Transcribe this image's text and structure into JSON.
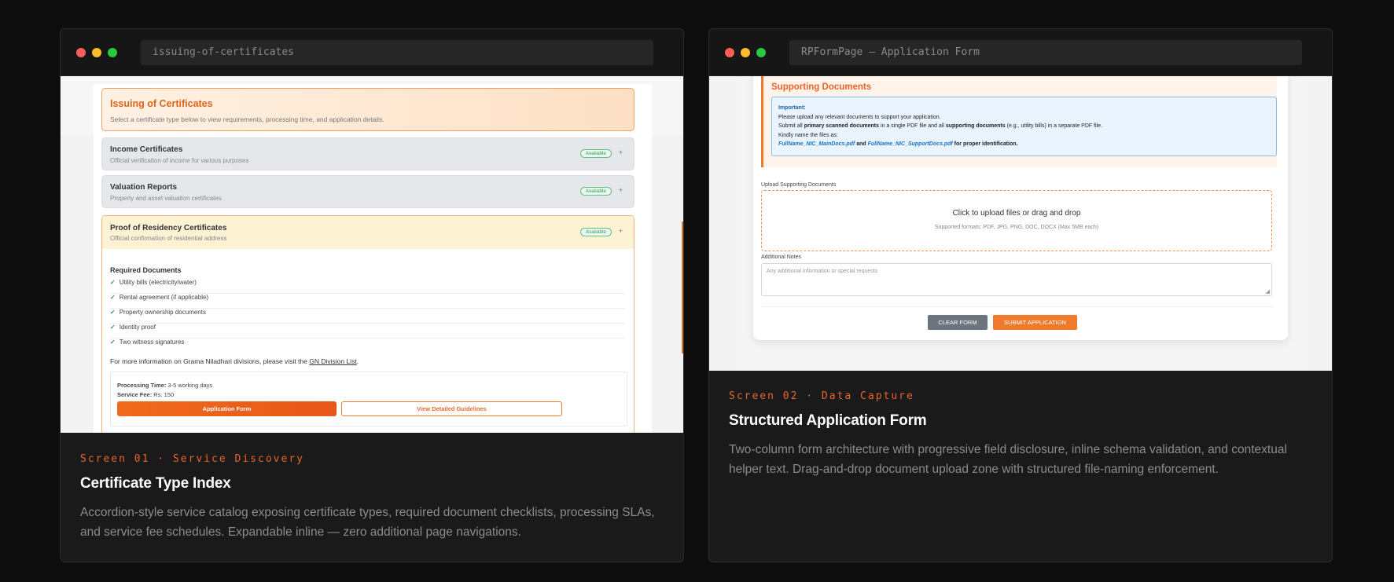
{
  "cards": [
    {
      "url": "issuing-of-certificates",
      "eyebrow": "Screen 01 · Service Discovery",
      "title": "Certificate Type Index",
      "description": "Accordion-style service catalog exposing certificate types, required document checklists, processing SLAs, and service fee schedules. Expandable inline — zero additional page navigations.",
      "screen": {
        "header_title": "Issuing of Certificates",
        "header_sub": "Select a certificate type below to view requirements, processing time, and application details.",
        "accordions": [
          {
            "title": "Income Certificates",
            "sub": "Official verification of income for various purposes",
            "badge": "Available",
            "toggle": "+"
          },
          {
            "title": "Valuation Reports",
            "sub": "Property and asset valuation certificates",
            "badge": "Available",
            "toggle": "+"
          },
          {
            "title": "Proof of Residency Certificates",
            "sub": "Official confirmation of residential address",
            "badge": "Available",
            "toggle": "+"
          }
        ],
        "required_heading": "Required Documents",
        "check": "✓",
        "required_docs": [
          "Utility bills (electricity/water)",
          "Rental agreement (if applicable)",
          "Property ownership documents",
          "Identity proof",
          "Two witness signatures"
        ],
        "more_prefix": "For more information on Grama Niladhari divisions, please visit the ",
        "more_link": "GN Division List",
        "more_suffix": ".",
        "processing_label": "Processing Time:",
        "processing_value": "3-5 working days",
        "fee_label": "Service Fee:",
        "fee_value": "Rs. 150",
        "primary_button": "Application Form",
        "secondary_button": "View Detailed Guidelines"
      }
    },
    {
      "url": "RPFormPage — Application Form",
      "eyebrow": "Screen 02 · Data Capture",
      "title": "Structured Application Form",
      "description": "Two-column form architecture with progressive field disclosure, inline schema validation, and contextual helper text. Drag-and-drop document upload zone with structured file-naming enforcement.",
      "screen": {
        "section_title": "Supporting Documents",
        "important_label": "Important:",
        "line1": "Please upload any relevant documents to support your application.",
        "line2_a": "Submit all ",
        "line2_b": "primary scanned documents",
        "line2_c": " in a single PDF file and all ",
        "line2_d": "supporting documents",
        "line2_e": " (e.g., utility bills) in a separate PDF file.",
        "line3": "Kindly name the files as:",
        "file1": "FullName_NIC_MainDocs.pdf",
        "and": " and ",
        "file2": "FullName_NIC_SupportDocs.pdf",
        "line4_suffix": " for proper identification.",
        "upload_label": "Upload Supporting Documents",
        "upload_title": "Click to upload files or drag and drop",
        "upload_formats": "Supported formats: PDF, JPG, PNG, DOC, DOCX (Max 5MB each)",
        "notes_label": "Additional Notes",
        "notes_placeholder": "Any additional information or special requests",
        "clear_button": "CLEAR FORM",
        "submit_button": "SUBMIT APPLICATION"
      }
    }
  ]
}
